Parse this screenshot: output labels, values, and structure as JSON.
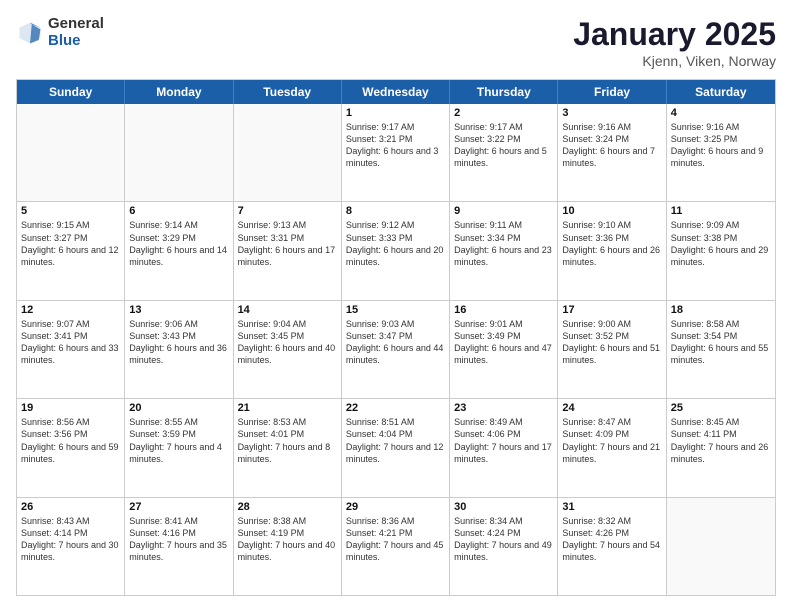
{
  "logo": {
    "general": "General",
    "blue": "Blue"
  },
  "header": {
    "title": "January 2025",
    "subtitle": "Kjenn, Viken, Norway"
  },
  "weekdays": [
    "Sunday",
    "Monday",
    "Tuesday",
    "Wednesday",
    "Thursday",
    "Friday",
    "Saturday"
  ],
  "weeks": [
    [
      {
        "day": "",
        "info": ""
      },
      {
        "day": "",
        "info": ""
      },
      {
        "day": "",
        "info": ""
      },
      {
        "day": "1",
        "info": "Sunrise: 9:17 AM\nSunset: 3:21 PM\nDaylight: 6 hours\nand 3 minutes."
      },
      {
        "day": "2",
        "info": "Sunrise: 9:17 AM\nSunset: 3:22 PM\nDaylight: 6 hours\nand 5 minutes."
      },
      {
        "day": "3",
        "info": "Sunrise: 9:16 AM\nSunset: 3:24 PM\nDaylight: 6 hours\nand 7 minutes."
      },
      {
        "day": "4",
        "info": "Sunrise: 9:16 AM\nSunset: 3:25 PM\nDaylight: 6 hours\nand 9 minutes."
      }
    ],
    [
      {
        "day": "5",
        "info": "Sunrise: 9:15 AM\nSunset: 3:27 PM\nDaylight: 6 hours\nand 12 minutes."
      },
      {
        "day": "6",
        "info": "Sunrise: 9:14 AM\nSunset: 3:29 PM\nDaylight: 6 hours\nand 14 minutes."
      },
      {
        "day": "7",
        "info": "Sunrise: 9:13 AM\nSunset: 3:31 PM\nDaylight: 6 hours\nand 17 minutes."
      },
      {
        "day": "8",
        "info": "Sunrise: 9:12 AM\nSunset: 3:33 PM\nDaylight: 6 hours\nand 20 minutes."
      },
      {
        "day": "9",
        "info": "Sunrise: 9:11 AM\nSunset: 3:34 PM\nDaylight: 6 hours\nand 23 minutes."
      },
      {
        "day": "10",
        "info": "Sunrise: 9:10 AM\nSunset: 3:36 PM\nDaylight: 6 hours\nand 26 minutes."
      },
      {
        "day": "11",
        "info": "Sunrise: 9:09 AM\nSunset: 3:38 PM\nDaylight: 6 hours\nand 29 minutes."
      }
    ],
    [
      {
        "day": "12",
        "info": "Sunrise: 9:07 AM\nSunset: 3:41 PM\nDaylight: 6 hours\nand 33 minutes."
      },
      {
        "day": "13",
        "info": "Sunrise: 9:06 AM\nSunset: 3:43 PM\nDaylight: 6 hours\nand 36 minutes."
      },
      {
        "day": "14",
        "info": "Sunrise: 9:04 AM\nSunset: 3:45 PM\nDaylight: 6 hours\nand 40 minutes."
      },
      {
        "day": "15",
        "info": "Sunrise: 9:03 AM\nSunset: 3:47 PM\nDaylight: 6 hours\nand 44 minutes."
      },
      {
        "day": "16",
        "info": "Sunrise: 9:01 AM\nSunset: 3:49 PM\nDaylight: 6 hours\nand 47 minutes."
      },
      {
        "day": "17",
        "info": "Sunrise: 9:00 AM\nSunset: 3:52 PM\nDaylight: 6 hours\nand 51 minutes."
      },
      {
        "day": "18",
        "info": "Sunrise: 8:58 AM\nSunset: 3:54 PM\nDaylight: 6 hours\nand 55 minutes."
      }
    ],
    [
      {
        "day": "19",
        "info": "Sunrise: 8:56 AM\nSunset: 3:56 PM\nDaylight: 6 hours\nand 59 minutes."
      },
      {
        "day": "20",
        "info": "Sunrise: 8:55 AM\nSunset: 3:59 PM\nDaylight: 7 hours\nand 4 minutes."
      },
      {
        "day": "21",
        "info": "Sunrise: 8:53 AM\nSunset: 4:01 PM\nDaylight: 7 hours\nand 8 minutes."
      },
      {
        "day": "22",
        "info": "Sunrise: 8:51 AM\nSunset: 4:04 PM\nDaylight: 7 hours\nand 12 minutes."
      },
      {
        "day": "23",
        "info": "Sunrise: 8:49 AM\nSunset: 4:06 PM\nDaylight: 7 hours\nand 17 minutes."
      },
      {
        "day": "24",
        "info": "Sunrise: 8:47 AM\nSunset: 4:09 PM\nDaylight: 7 hours\nand 21 minutes."
      },
      {
        "day": "25",
        "info": "Sunrise: 8:45 AM\nSunset: 4:11 PM\nDaylight: 7 hours\nand 26 minutes."
      }
    ],
    [
      {
        "day": "26",
        "info": "Sunrise: 8:43 AM\nSunset: 4:14 PM\nDaylight: 7 hours\nand 30 minutes."
      },
      {
        "day": "27",
        "info": "Sunrise: 8:41 AM\nSunset: 4:16 PM\nDaylight: 7 hours\nand 35 minutes."
      },
      {
        "day": "28",
        "info": "Sunrise: 8:38 AM\nSunset: 4:19 PM\nDaylight: 7 hours\nand 40 minutes."
      },
      {
        "day": "29",
        "info": "Sunrise: 8:36 AM\nSunset: 4:21 PM\nDaylight: 7 hours\nand 45 minutes."
      },
      {
        "day": "30",
        "info": "Sunrise: 8:34 AM\nSunset: 4:24 PM\nDaylight: 7 hours\nand 49 minutes."
      },
      {
        "day": "31",
        "info": "Sunrise: 8:32 AM\nSunset: 4:26 PM\nDaylight: 7 hours\nand 54 minutes."
      },
      {
        "day": "",
        "info": ""
      }
    ]
  ]
}
